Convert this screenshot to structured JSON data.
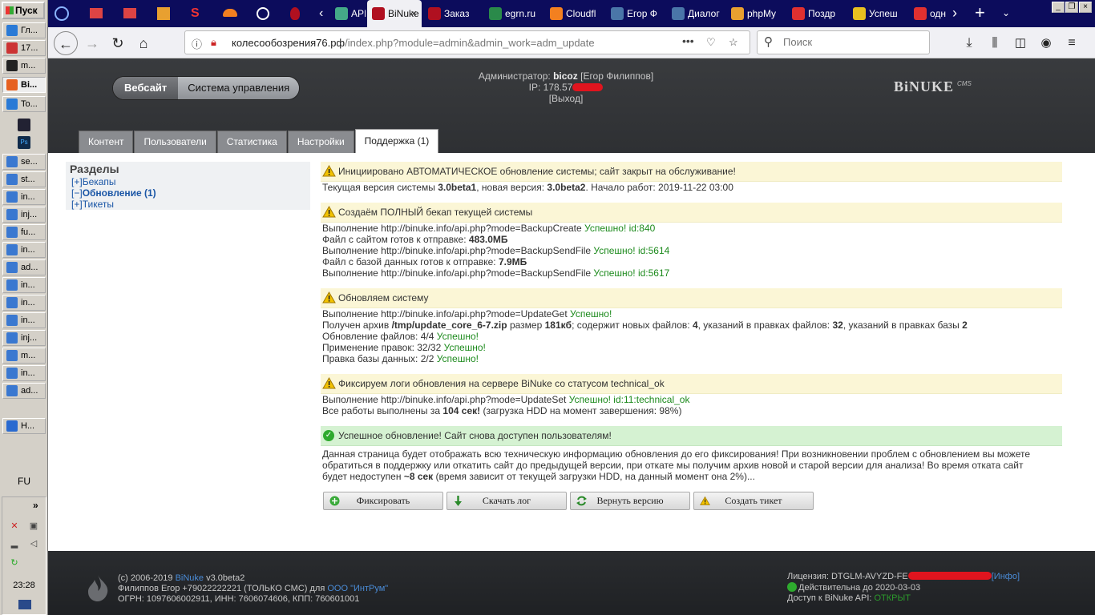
{
  "taskbar": {
    "start_label": "Пуск",
    "items": [
      {
        "label": "Гл...",
        "active": false
      },
      {
        "label": "17...",
        "active": false
      },
      {
        "label": "m...",
        "active": false
      },
      {
        "label": "Bi...",
        "active": true
      },
      {
        "label": "To...",
        "active": false
      },
      {
        "label": "se...",
        "active": false
      },
      {
        "label": "st...",
        "active": false
      },
      {
        "label": "in...",
        "active": false
      },
      {
        "label": "inj...",
        "active": false
      },
      {
        "label": "fu...",
        "active": false
      },
      {
        "label": "in...",
        "active": false
      },
      {
        "label": "ad...",
        "active": false
      },
      {
        "label": "in...",
        "active": false
      },
      {
        "label": "in...",
        "active": false
      },
      {
        "label": "in...",
        "active": false
      },
      {
        "label": "inj...",
        "active": false
      },
      {
        "label": "m...",
        "active": false
      },
      {
        "label": "in...",
        "active": false
      },
      {
        "label": "ad...",
        "active": false
      },
      {
        "label": "H...",
        "active": false
      }
    ],
    "lang": "FU",
    "expand": "»",
    "clock": "23:28"
  },
  "browser": {
    "tabs": [
      {
        "label": "API",
        "active": false
      },
      {
        "label": "BiNuke",
        "active": true
      },
      {
        "label": "Заказ",
        "active": false
      },
      {
        "label": "egrn.ru",
        "active": false
      },
      {
        "label": "Cloudfl",
        "active": false
      },
      {
        "label": "Егор Ф",
        "active": false
      },
      {
        "label": "Диалог",
        "active": false
      },
      {
        "label": "phpMy",
        "active": false
      },
      {
        "label": "Поздр",
        "active": false
      },
      {
        "label": "Успеш",
        "active": false
      },
      {
        "label": "одн",
        "active": false
      }
    ],
    "url_domain": "колесообозрения76.рф",
    "url_path": "/index.php?module=admin&admin_work=adm_update",
    "url_more": "•••",
    "search_placeholder": "Поиск"
  },
  "header": {
    "btn_site": "Вебсайт",
    "btn_admin": "Система управления",
    "admin_prefix": "Администратор:",
    "admin_login": "bicoz",
    "admin_name": "[Егор Филиппов]",
    "ip_label": "IP:",
    "ip_value": "178.57",
    "logout": "[Выход]",
    "logo": "BiNUKE",
    "logo_sup": "CMS"
  },
  "tabs": [
    {
      "label": "Контент",
      "active": false
    },
    {
      "label": "Пользователи",
      "active": false
    },
    {
      "label": "Статистика",
      "active": false
    },
    {
      "label": "Настройки",
      "active": false
    },
    {
      "label": "Поддержка (1)",
      "active": true
    }
  ],
  "sidebar": {
    "title": "Разделы",
    "items": [
      {
        "toggle": "[+]",
        "label": "Бекапы",
        "current": false
      },
      {
        "toggle": "[−]",
        "label": "Обновление (1)",
        "current": true
      },
      {
        "toggle": "[+]",
        "label": "Тикеты",
        "current": false
      }
    ]
  },
  "sections": {
    "s1": {
      "head": "Инициировано АВТОМАТИЧЕСКОЕ обновление системы; сайт закрыт на обслуживание!",
      "l1_a": "Текущая версия системы",
      "l1_v1": "3.0beta1",
      "l1_b": ", новая версия:",
      "l1_v2": "3.0beta2",
      "l1_c": ". Начало работ: 2019-11-22 03:00"
    },
    "s2": {
      "head": "Создаём ПОЛНЫЙ бекап текущей системы",
      "l1": "Выполнение http://binuke.info/api.php?mode=BackupCreate",
      "l1_ok": "Успешно! id:840",
      "l2": "Файл с сайтом готов к отправке:",
      "l2_v": "483.0МБ",
      "l3": "Выполнение http://binuke.info/api.php?mode=BackupSendFile",
      "l3_ok": "Успешно! id:5614",
      "l4": "Файл с базой данных готов к отправке:",
      "l4_v": "7.9МБ",
      "l5": "Выполнение http://binuke.info/api.php?mode=BackupSendFile",
      "l5_ok": "Успешно! id:5617"
    },
    "s3": {
      "head": "Обновляем систему",
      "l1": "Выполнение http://binuke.info/api.php?mode=UpdateGet",
      "l1_ok": "Успешно!",
      "l2_a": "Получен архив",
      "l2_file": "/tmp/update_core_6-7.zip",
      "l2_b": "размер",
      "l2_size": "181кб",
      "l2_c": "; содержит новых файлов:",
      "l2_files": "4",
      "l2_d": ", указаний в правках файлов:",
      "l2_edits": "32",
      "l2_e": ", указаний в правках базы",
      "l2_db": "2",
      "l3": "Обновление файлов: 4/4",
      "l3_ok": "Успешно!",
      "l4": "Применение правок: 32/32",
      "l4_ok": "Успешно!",
      "l5": "Правка базы данных: 2/2",
      "l5_ok": "Успешно!"
    },
    "s4": {
      "head": "Фиксируем логи обновления на сервере BiNuke со статусом technical_ok",
      "l1": "Выполнение http://binuke.info/api.php?mode=UpdateSet",
      "l1_ok": "Успешно! id:11:technical_ok",
      "l2_a": "Все работы выполнены за",
      "l2_time": "104 сек!",
      "l2_b": "(загрузка HDD на момент завершения: 98%)"
    },
    "s5": {
      "head": "Успешное обновление! Сайт снова доступен пользователям!",
      "p1": "Данная страница будет отображать всю техническую информацию обновления до его фиксирования! При возникновении проблем с обновлением вы можете",
      "p2": "обратиться в поддержку или откатить сайт до предыдущей версии, при откате мы получим архив новой и старой версии для анализа! Во время отката сайт",
      "p3_a": "будет недоступен",
      "p3_time": "~8 сек",
      "p3_b": "(время зависит от текущей загрузки HDD, на данный момент она 2%)..."
    }
  },
  "actions": {
    "fix": "Фиксировать",
    "download": "Скачать лог",
    "revert": "Вернуть версию",
    "ticket": "Создать тикет"
  },
  "footer": {
    "l1_a": "(c) 2006-2019",
    "l1_link": "BiNuke",
    "l1_b": "v3.0beta2",
    "l2_a": "Филиппов Егор +79022222221 (ТОЛЬКО СМС) для",
    "l2_link": "ООО \"ИнтРум\"",
    "l3": "ОГРН: 1097606002911, ИНН: 7606074606, КПП: 760601001",
    "lic_label": "Лицензия: DTGLM-AVYZD-FE",
    "lic_info": "[Инфо]",
    "valid": "Действительна до 2020-03-03",
    "api_label": "Доступ к BiNuke API:",
    "api_status": "ОТКРЫТ"
  },
  "colors": {
    "header_bg": "#393b3e",
    "warn_bg": "#fbf6d6",
    "ok_bg": "#d5f2d2",
    "success_text": "#1c8a1c",
    "link": "#1a56a6",
    "tabbar": "#0c0c5c",
    "redaction": "#e0141e"
  }
}
